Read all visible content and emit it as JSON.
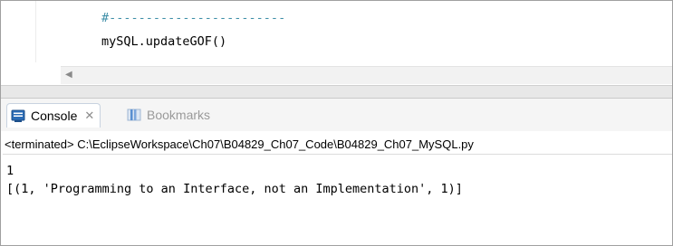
{
  "editor": {
    "lines": [
      "#------------------------",
      "mySQL.updateGOF()"
    ]
  },
  "scrollbar": {
    "left_arrow": "◀"
  },
  "views": {
    "tabs": [
      {
        "label": "Console",
        "icon": "console-icon",
        "active": true,
        "close": "✕"
      },
      {
        "label": "Bookmarks",
        "icon": "bookmarks-icon",
        "active": false
      }
    ]
  },
  "console": {
    "status": "<terminated> C:\\EclipseWorkspace\\Ch07\\B04829_Ch07_Code\\B04829_Ch07_MySQL.py",
    "output": [
      "1",
      "[(1, 'Programming to an Interface, not an Implementation', 1)]"
    ]
  },
  "colors": {
    "comment": "#3f8fa8",
    "accent": "#1e5aa8"
  }
}
